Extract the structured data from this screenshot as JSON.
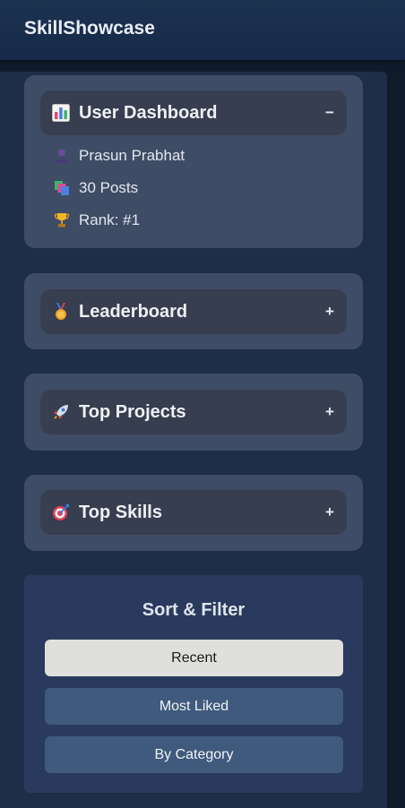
{
  "header": {
    "brand": "SkillShowcase"
  },
  "dashboard": {
    "title": "User Dashboard",
    "toggle": "−",
    "stats": [
      {
        "icon": "user-icon",
        "label": "Prasun Prabhat"
      },
      {
        "icon": "posts-icon",
        "label": "30 Posts"
      },
      {
        "icon": "trophy-icon",
        "label": "Rank: #1"
      }
    ]
  },
  "sections": [
    {
      "icon": "medal-icon",
      "title": "Leaderboard",
      "toggle": "+"
    },
    {
      "icon": "rocket-icon",
      "title": "Top Projects",
      "toggle": "+"
    },
    {
      "icon": "target-icon",
      "title": "Top Skills",
      "toggle": "+"
    }
  ],
  "filter": {
    "title": "Sort & Filter",
    "options": [
      "Recent",
      "Most Liked",
      "By Category"
    ],
    "selected": "Recent"
  }
}
